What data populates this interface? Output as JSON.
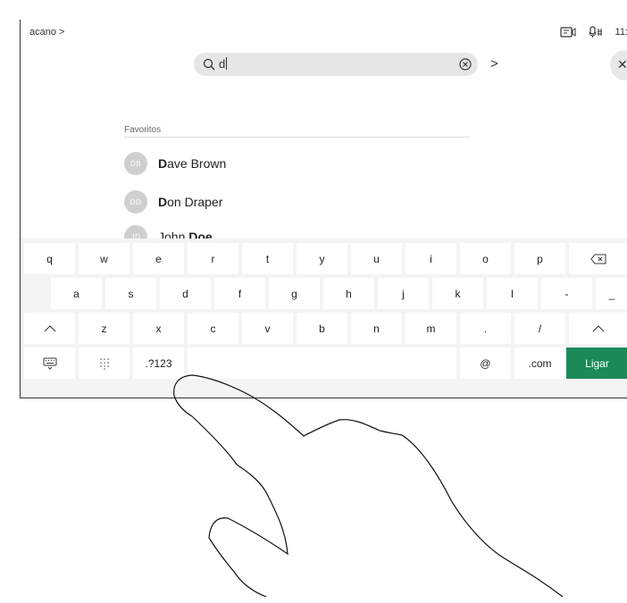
{
  "topbar": {
    "brand": "acano >",
    "time": "11:"
  },
  "search": {
    "query": "d"
  },
  "favorites": {
    "label": "Favoritos",
    "contacts": [
      {
        "initials": "DB",
        "first": "D",
        "rest": "ave Brown"
      },
      {
        "initials": "DD",
        "first": "D",
        "rest": "on Draper"
      },
      {
        "initials": "JD",
        "first": "John ",
        "rest": "Doe"
      }
    ]
  },
  "keyboard": {
    "row1": [
      "q",
      "w",
      "e",
      "r",
      "t",
      "y",
      "u",
      "i",
      "o",
      "p"
    ],
    "row2": [
      "a",
      "s",
      "d",
      "f",
      "g",
      "h",
      "j",
      "k",
      "l",
      "-",
      "_"
    ],
    "row3": [
      "z",
      "x",
      "c",
      "v",
      "b",
      "n",
      "m",
      ".",
      "/"
    ],
    "symbols_label": ".?123",
    "at_label": "@",
    "com_label": ".com",
    "call_label": "Ligar",
    "call_color": "#1b8a58"
  },
  "icons": {
    "search": "search-icon",
    "clear": "clear-circle-icon",
    "backspace": "backspace-icon",
    "shift": "shift-icon",
    "hide_keyboard": "keyboard-hide-icon",
    "dialpad": "dialpad-icon",
    "share_screen": "screen-share-icon",
    "mic": "microphone-icon",
    "close": "close-icon",
    "hand": "hand-gesture-icon"
  }
}
